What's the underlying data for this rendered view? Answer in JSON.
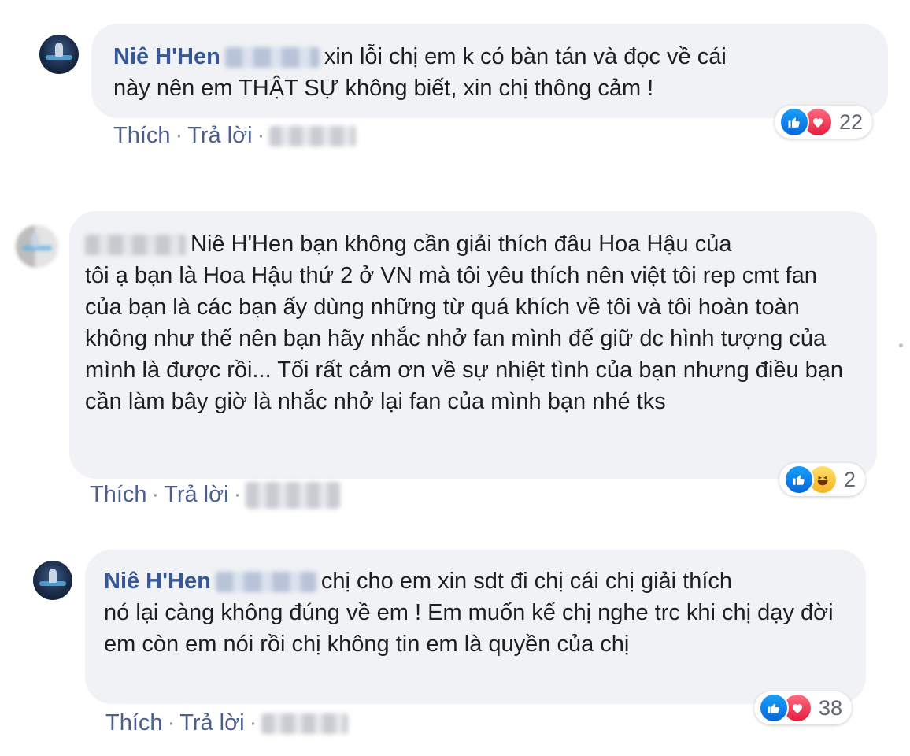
{
  "comments": [
    {
      "author": "Niê H'Hen",
      "text_line1": "xin lỗi chị em k có bàn tán và đọc về cái",
      "text_rest": "này nên em THẬT SỰ không biết, xin chị thông cảm !",
      "actions": {
        "like": "Thích",
        "reply": "Trả lời",
        "sep": "·"
      },
      "reactions": {
        "types": [
          "like-icon",
          "love-icon"
        ],
        "count": "22"
      }
    },
    {
      "author": "",
      "text_line1": "Niê H'Hen bạn không cần giải thích đâu Hoa Hậu của",
      "text_rest": "tôi ạ bạn là Hoa Hậu thứ 2 ở VN mà tôi yêu thích nên việt tôi rep cmt fan của bạn là các bạn ấy dùng những từ quá khích về tôi và tôi hoàn toàn không như thế nên bạn hãy nhắc nhở fan mình để giữ dc hình tượng của mình là được rồi... Tối rất cảm ơn về sự nhiệt tình của bạn nhưng điều bạn cần làm bây giờ là nhắc nhở lại fan của mình bạn nhé tks",
      "actions": {
        "like": "Thích",
        "reply": "Trả lời",
        "sep": "·"
      },
      "reactions": {
        "types": [
          "like-icon",
          "haha-icon"
        ],
        "count": "2"
      }
    },
    {
      "author": "Niê H'Hen",
      "text_line1": "chị cho em xin sdt đi chị cái chị giải thích",
      "text_rest": "nó lại càng không đúng về em ! Em muốn kể chị nghe trc khi chị dạy đời em còn em nói rồi chị không tin em là quyền của chị",
      "actions": {
        "like": "Thích",
        "reply": "Trả lời",
        "sep": "·"
      },
      "reactions": {
        "types": [
          "like-icon",
          "love-icon"
        ],
        "count": "38"
      }
    }
  ],
  "colors": {
    "author": "#365899",
    "bubble": "#f0f2f5",
    "link": "#4b5e8c",
    "like": "#0866d8",
    "love": "#e41e3f",
    "haha": "#f7b125"
  }
}
